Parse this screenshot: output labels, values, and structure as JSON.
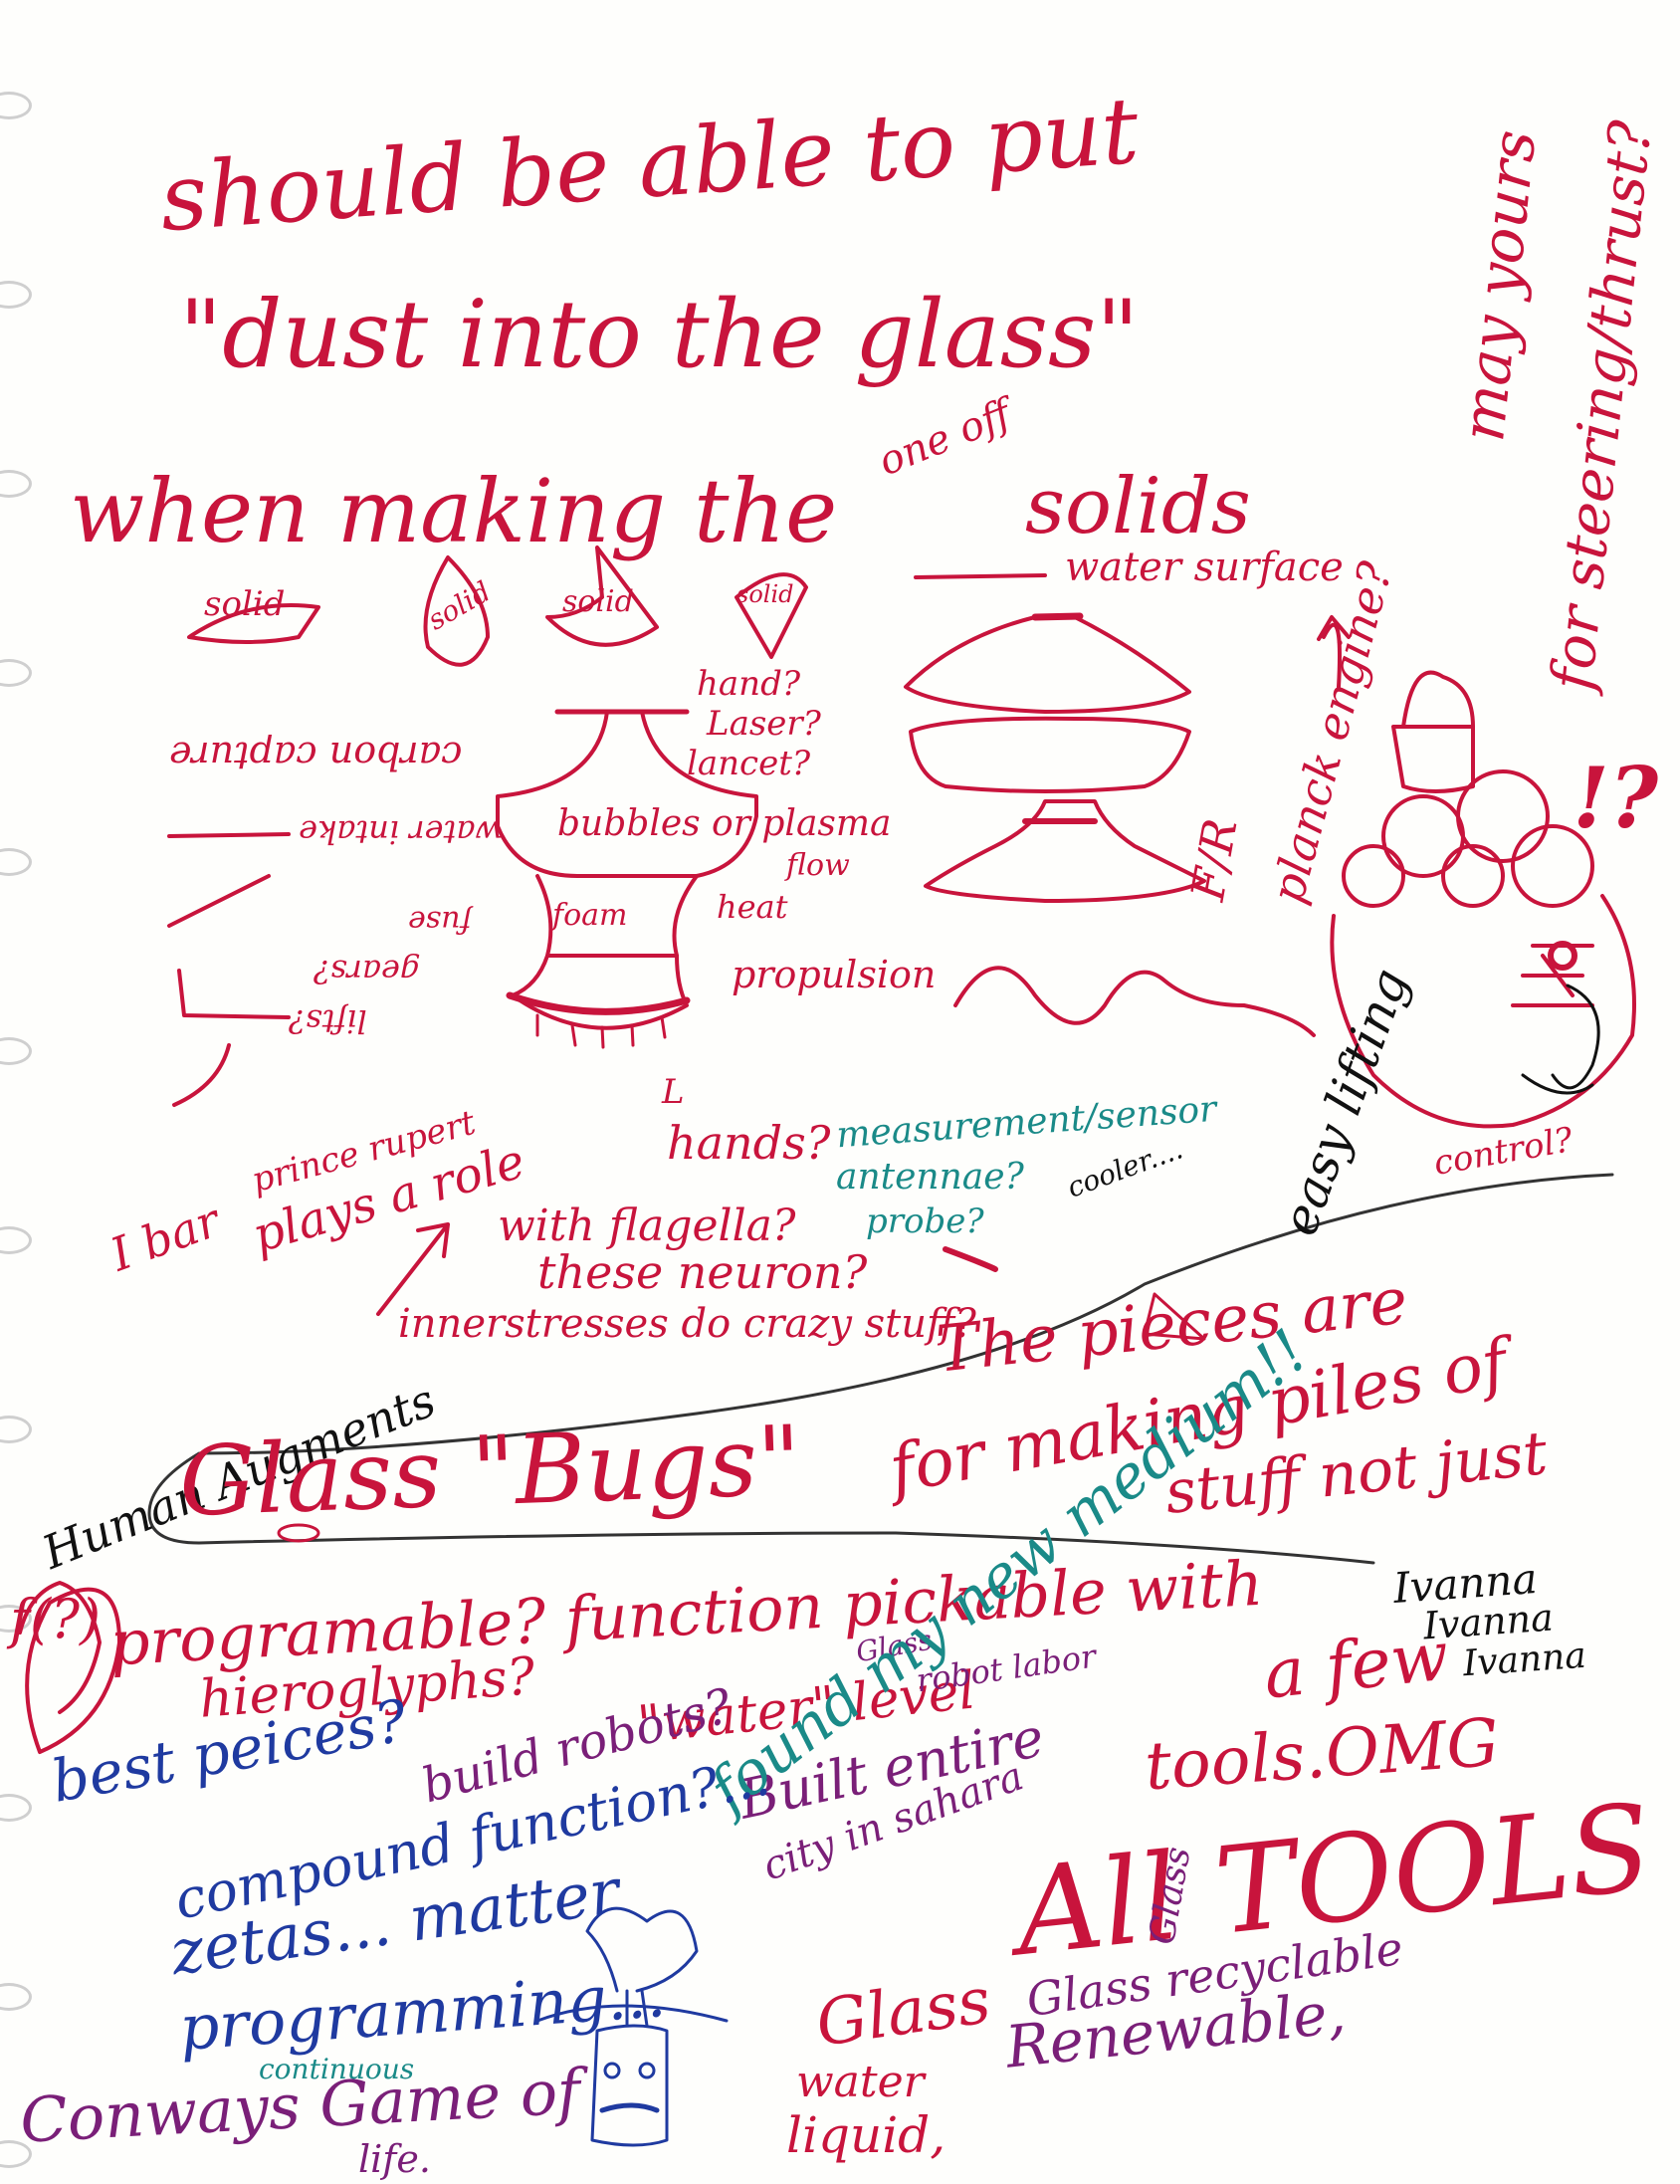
{
  "page": {
    "colors": {
      "red_ink": "#c8143c",
      "blue_ink": "#1f3aa0",
      "purple_ink": "#7a1f78",
      "teal_ink": "#1a8a88",
      "black_ink": "#111111",
      "paper": "#fefefc"
    },
    "heading": {
      "line1": "should be able to put",
      "line2": "\"dust into the glass\"",
      "line3": "when making the",
      "one_off": "one off",
      "solids": "solids"
    },
    "right_margin": {
      "may_yours": "may yours",
      "for_steering": "for steering/thrust?",
      "exclaim": "!?",
      "planck_engine": "planck engine?",
      "fr": "F/R",
      "control": "control?",
      "easy_lifting": "easy lifting"
    },
    "sketch_labels": {
      "solid1": "solid",
      "solid2": "solid",
      "solid3": "solid",
      "solid4": "solid",
      "water_surface": "water surface",
      "hand": "hand?",
      "laser": "Laser?",
      "lancet": "lancet?",
      "bubbles": "bubbles or plasma",
      "flow": "flow",
      "heat": "heat",
      "propulsion": "propulsion",
      "foam": "foam",
      "L_mark": "L",
      "carbon_capture": "carbon capture",
      "water_intake": "water intake",
      "fuse": "fuse",
      "gears": "gears?",
      "lifts": "lifts?"
    },
    "middle": {
      "ibar": "I bar",
      "prince_rupert": "prince rupert",
      "plays_role": "plays a role",
      "hands": "hands?",
      "measurement": "measurement/sensor",
      "antennae": "antennae?",
      "probe": "probe?",
      "cooler": "cooler....",
      "with_flagella": "with flagella?",
      "these_neuron": "these neuron?",
      "inner_stresses": "innerstresses do crazy stuff?",
      "human_augments": "Human Augments",
      "the_pieces": "The pieces are",
      "glass_bugs": "Glass \"Bugs\"",
      "making_piles": "for making piles of",
      "stuff_not_just": "stuff not just",
      "a_few": "a few",
      "tools_omg": "tools.OMG"
    },
    "lower": {
      "programable": "programable? function pickable with",
      "hieroglyphs": "hieroglyphs?",
      "water_level": "\"water\" level",
      "glass_small": "Glass",
      "robot_labor": "robot labor",
      "best_pieces": "best peices?",
      "build_robots": "build robots?",
      "built_entire": "Built entire",
      "city_sahara": "city in sahara",
      "new_medium": "found my new medium!!",
      "ivanna": [
        "Ivanna",
        "Ivanna",
        "Ivanna"
      ],
      "compound": "compound function?...",
      "all_tools": "All TOOLS",
      "glass_vert": "Glass",
      "zetas": "zetas... matter",
      "programming": "programming...",
      "continuous": "continuous",
      "conways": "Conways Game of",
      "life": "life.",
      "glass_recyclable": "Glass recyclable",
      "renewable": "Renewable,",
      "water": "water",
      "liquid": "liquid,",
      "f_mark": "f(?)"
    }
  }
}
